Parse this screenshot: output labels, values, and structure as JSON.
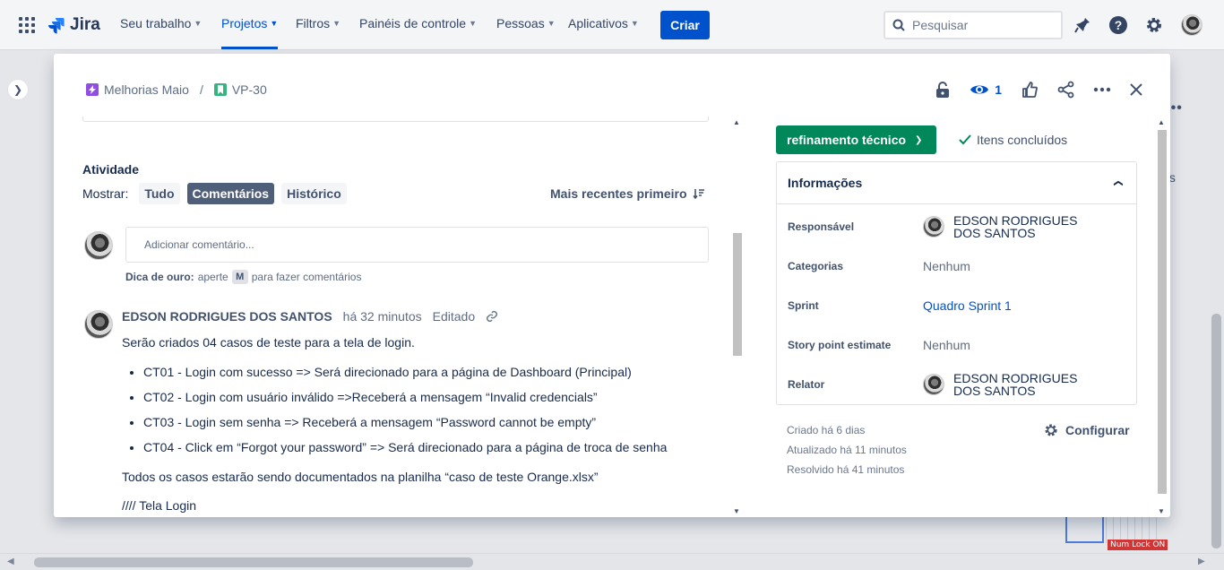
{
  "topnav": {
    "logo_text": "Jira",
    "items": [
      {
        "label": "Seu trabalho",
        "active": false
      },
      {
        "label": "Projetos",
        "active": true
      },
      {
        "label": "Filtros",
        "active": false
      },
      {
        "label": "Painéis de controle",
        "active": false
      },
      {
        "label": "Pessoas",
        "active": false
      },
      {
        "label": "Aplicativos",
        "active": false
      }
    ],
    "create_label": "Criar",
    "search_placeholder": "Pesquisar",
    "icons": [
      "notifications-icon",
      "help-icon",
      "settings-icon",
      "profile-avatar"
    ]
  },
  "background": {
    "dots_label": "•••",
    "partial_text": "ts",
    "numlock_label": "Num Lock ON"
  },
  "modal": {
    "breadcrumb": {
      "epic_label": "Melhorias Maio",
      "separator": "/",
      "issue_key": "VP-30"
    },
    "watch_count": "1",
    "activity": {
      "title": "Atividade",
      "show_label": "Mostrar:",
      "filters": [
        "Tudo",
        "Comentários",
        "Histórico"
      ],
      "selected_filter": "Comentários",
      "sort_label": "Mais recentes primeiro",
      "comment_placeholder": "Adicionar comentário...",
      "tip_bold": "Dica de ouro:",
      "tip_before": "aperte",
      "tip_key": "M",
      "tip_after": "para fazer comentários"
    },
    "comment": {
      "author": "EDSON RODRIGUES DOS SANTOS",
      "time": "há 32 minutos",
      "edited": "Editado",
      "intro": "Serão criados 04 casos de teste para a tela de login.",
      "items": [
        "CT01 - Login com sucesso => Será direcionado para a página de Dashboard (Principal)",
        "CT02 - Login com usuário inválido =>Receberá a mensagem “Invalid credencials”",
        "CT03 - Login sem senha => Receberá a mensagem “Password cannot be empty”",
        "CT04 - Click em “Forgot your password” => Será direcionado para a página de troca de senha"
      ],
      "outro": "Todos os casos estarão sendo documentados na planilha “caso de teste Orange.xlsx”",
      "cut_line": "//// Tela Login"
    },
    "status": {
      "label": "refinamento técnico",
      "color": "#00875a",
      "done_label": "Itens concluídos"
    },
    "details": {
      "title": "Informações",
      "rows": [
        {
          "label": "Responsável",
          "value": "EDSON RODRIGUES DOS SANTOS"
        },
        {
          "label": "Categorias",
          "value": "Nenhum"
        },
        {
          "label": "Sprint",
          "value": "Quadro Sprint 1"
        },
        {
          "label": "Story point estimate",
          "value": "Nenhum"
        },
        {
          "label": "Relator",
          "value": "EDSON RODRIGUES DOS SANTOS"
        }
      ]
    },
    "meta": {
      "created": "Criado há 6 dias",
      "updated": "Atualizado há 11 minutos",
      "resolved": "Resolvido há 41 minutos"
    },
    "configure_label": "Configurar"
  }
}
